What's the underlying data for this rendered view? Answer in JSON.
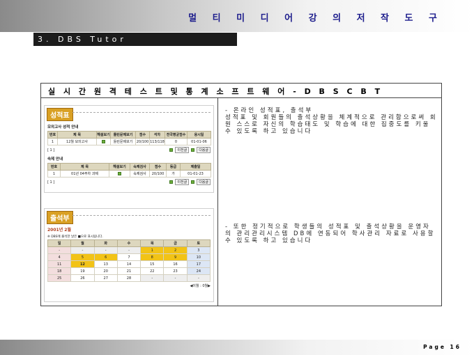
{
  "header": {
    "title": "멀 티 미 디 어  강 의  저 작  도 구"
  },
  "section": {
    "label": "3. DBS Tutor"
  },
  "frame": {
    "heading": "실 시 간  원 격  테 스 트  및  통 계  소 프 트 웨 어  -  D B S  C B T",
    "desc1": "- 온라인 성적표, 출석부\n성적표 및 회원들의 출석상황을 체계적으로 관리함으로써 회원 스스로 자신의 학습태도 및 학습에 대한 집중도를 키울 수 있도록 하고 있습니다",
    "desc2": "- 또한 정기적으로 학생들의 성적표 및 출석상황을 운영자의 관리관리시스템 DB에 연동되어 학사관리 자료로 사용할 수 있도록 하고 있습니다"
  },
  "grade_panel": {
    "title": "성적표",
    "exam_section": "모의고사 성적 안내",
    "exam_headers": [
      "번호",
      "제 목",
      "해설보기",
      "틀린문제보기",
      "점수",
      "석차",
      "전국평균점수",
      "응시일"
    ],
    "exam_rows": [
      [
        "1",
        "12월 모의고사",
        "",
        "틀린문제보기",
        "20/100",
        "113/118",
        "0",
        "01-01-06"
      ]
    ],
    "exam_count": "[ 1 ]",
    "prev": "이전글",
    "next": "다음글",
    "hw_section": "숙제 안내",
    "hw_headers": [
      "번호",
      "제 목",
      "해설보기",
      "숙제검사",
      "점수",
      "등급",
      "제출일"
    ],
    "hw_rows": [
      [
        "1",
        "01년 04주차 과제",
        "",
        "숙제검사",
        "20/100",
        "가",
        "01-01-23"
      ]
    ],
    "hw_count": "[ 1 ]"
  },
  "attendance_panel": {
    "title": "출석부",
    "month": "2001년 2월",
    "note": "※ DBS에 출석한 날은 ■으로 표시됩니다.",
    "weekdays": [
      "일",
      "월",
      "화",
      "수",
      "목",
      "금",
      "토"
    ],
    "weeks": [
      [
        "-",
        "-",
        "-",
        "-",
        "1",
        "2",
        "3"
      ],
      [
        "4",
        "5",
        "6",
        "7",
        "8",
        "9",
        "10"
      ],
      [
        "11",
        "12",
        "13",
        "14",
        "15",
        "16",
        "17"
      ],
      [
        "18",
        "19",
        "20",
        "21",
        "22",
        "23",
        "24"
      ],
      [
        "25",
        "26",
        "27",
        "28",
        "-",
        "-",
        "-"
      ]
    ],
    "nav": "◀이월 : 0월▶"
  },
  "footer": {
    "page": "Page 16"
  }
}
